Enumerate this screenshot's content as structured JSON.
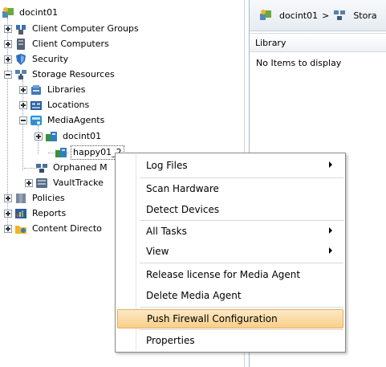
{
  "tree": {
    "root": "docint01",
    "items": [
      {
        "label": "Client Computer Groups",
        "icon": "client-groups-icon"
      },
      {
        "label": "Client Computers",
        "icon": "client-computers-icon"
      },
      {
        "label": "Security",
        "icon": "security-shield-icon"
      },
      {
        "label": "Storage Resources",
        "icon": "storage-resources-icon"
      },
      {
        "label": "Libraries",
        "icon": "libraries-icon"
      },
      {
        "label": "Locations",
        "icon": "locations-icon"
      },
      {
        "label": "MediaAgents",
        "icon": "mediaagents-icon"
      },
      {
        "label": "docint01",
        "icon": "mediaagent-server-icon"
      },
      {
        "label": "happy01_2",
        "icon": "mediaagent-server-icon"
      },
      {
        "label": "Orphaned M",
        "icon": "orphaned-media-icon"
      },
      {
        "label": "VaultTracke",
        "icon": "vaulttracker-icon"
      },
      {
        "label": "Policies",
        "icon": "policies-icon"
      },
      {
        "label": "Reports",
        "icon": "reports-icon"
      },
      {
        "label": "Content Directo",
        "icon": "content-director-icon"
      }
    ]
  },
  "right_pane": {
    "breadcrumb": [
      "docint01",
      ">",
      "Stora"
    ],
    "column_header": "Library",
    "empty_message": "No Items to display"
  },
  "context_menu": {
    "items": [
      {
        "label": "Log Files",
        "submenu": true
      },
      {
        "label": "Scan Hardware"
      },
      {
        "label": "Detect Devices"
      },
      {
        "label": "All Tasks",
        "submenu": true
      },
      {
        "label": "View",
        "submenu": true
      },
      {
        "label": "Release license for Media Agent"
      },
      {
        "label": "Delete Media Agent"
      },
      {
        "label": "Push Firewall Configuration",
        "highlighted": true
      },
      {
        "label": "Properties"
      }
    ]
  },
  "colors": {
    "menu_highlight": "#f8cf8a",
    "menu_highlight_border": "#e4b164",
    "tree_lines": "#9aa3ad"
  }
}
